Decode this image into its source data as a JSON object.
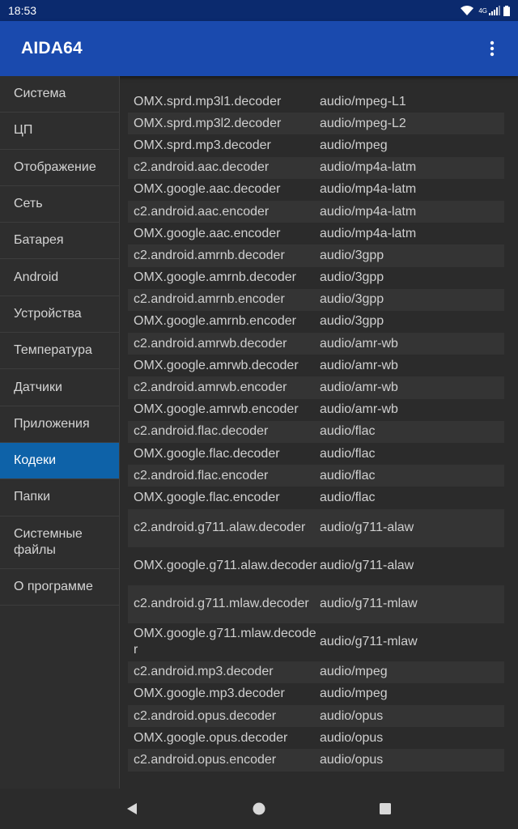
{
  "status_bar": {
    "time": "18:53",
    "network": "4G"
  },
  "app_bar": {
    "title": "AIDA64",
    "menu_icon": "more-vert-icon"
  },
  "sidebar": {
    "items": [
      {
        "label": "Система"
      },
      {
        "label": "ЦП"
      },
      {
        "label": "Отображение"
      },
      {
        "label": "Сеть"
      },
      {
        "label": "Батарея"
      },
      {
        "label": "Android"
      },
      {
        "label": "Устройства"
      },
      {
        "label": "Температура"
      },
      {
        "label": "Датчики"
      },
      {
        "label": "Приложения"
      },
      {
        "label": "Кодеки",
        "selected": true
      },
      {
        "label": "Папки"
      },
      {
        "label": "Системные файлы"
      },
      {
        "label": "О программе"
      }
    ],
    "selected_color": "#0e62a8"
  },
  "codecs": [
    {
      "name": "OMX.sprd.mp3l1.decoder",
      "type": "audio/mpeg-L1"
    },
    {
      "name": "OMX.sprd.mp3l2.decoder",
      "type": "audio/mpeg-L2"
    },
    {
      "name": "OMX.sprd.mp3.decoder",
      "type": "audio/mpeg"
    },
    {
      "name": "c2.android.aac.decoder",
      "type": "audio/mp4a-latm"
    },
    {
      "name": "OMX.google.aac.decoder",
      "type": "audio/mp4a-latm"
    },
    {
      "name": "c2.android.aac.encoder",
      "type": "audio/mp4a-latm"
    },
    {
      "name": "OMX.google.aac.encoder",
      "type": "audio/mp4a-latm"
    },
    {
      "name": "c2.android.amrnb.decoder",
      "type": "audio/3gpp"
    },
    {
      "name": "OMX.google.amrnb.decoder",
      "type": "audio/3gpp"
    },
    {
      "name": "c2.android.amrnb.encoder",
      "type": "audio/3gpp"
    },
    {
      "name": "OMX.google.amrnb.encoder",
      "type": "audio/3gpp"
    },
    {
      "name": "c2.android.amrwb.decoder",
      "type": "audio/amr-wb"
    },
    {
      "name": "OMX.google.amrwb.decoder",
      "type": "audio/amr-wb"
    },
    {
      "name": "c2.android.amrwb.encoder",
      "type": "audio/amr-wb"
    },
    {
      "name": "OMX.google.amrwb.encoder",
      "type": "audio/amr-wb"
    },
    {
      "name": "c2.android.flac.decoder",
      "type": "audio/flac"
    },
    {
      "name": "OMX.google.flac.decoder",
      "type": "audio/flac"
    },
    {
      "name": "c2.android.flac.encoder",
      "type": "audio/flac"
    },
    {
      "name": "OMX.google.flac.encoder",
      "type": "audio/flac"
    },
    {
      "name": "c2.android.g711.alaw.decoder",
      "type": "audio/g711-alaw"
    },
    {
      "name": "OMX.google.g711.alaw.decoder",
      "type": "audio/g711-alaw"
    },
    {
      "name": "c2.android.g711.mlaw.decoder",
      "type": "audio/g711-mlaw"
    },
    {
      "name": "OMX.google.g711.mlaw.decoder",
      "type": "audio/g711-mlaw"
    },
    {
      "name": "c2.android.mp3.decoder",
      "type": "audio/mpeg"
    },
    {
      "name": "OMX.google.mp3.decoder",
      "type": "audio/mpeg"
    },
    {
      "name": "c2.android.opus.decoder",
      "type": "audio/opus"
    },
    {
      "name": "OMX.google.opus.decoder",
      "type": "audio/opus"
    },
    {
      "name": "c2.android.opus.encoder",
      "type": "audio/opus"
    }
  ],
  "nav_bar": {
    "back_icon": "back-triangle-icon",
    "home_icon": "home-circle-icon",
    "recents_icon": "recents-square-icon"
  },
  "colors": {
    "status_bar": "#0b2a6e",
    "app_bar": "#1a4aae",
    "background": "#2b2b2b",
    "row_alt": "#343434"
  }
}
